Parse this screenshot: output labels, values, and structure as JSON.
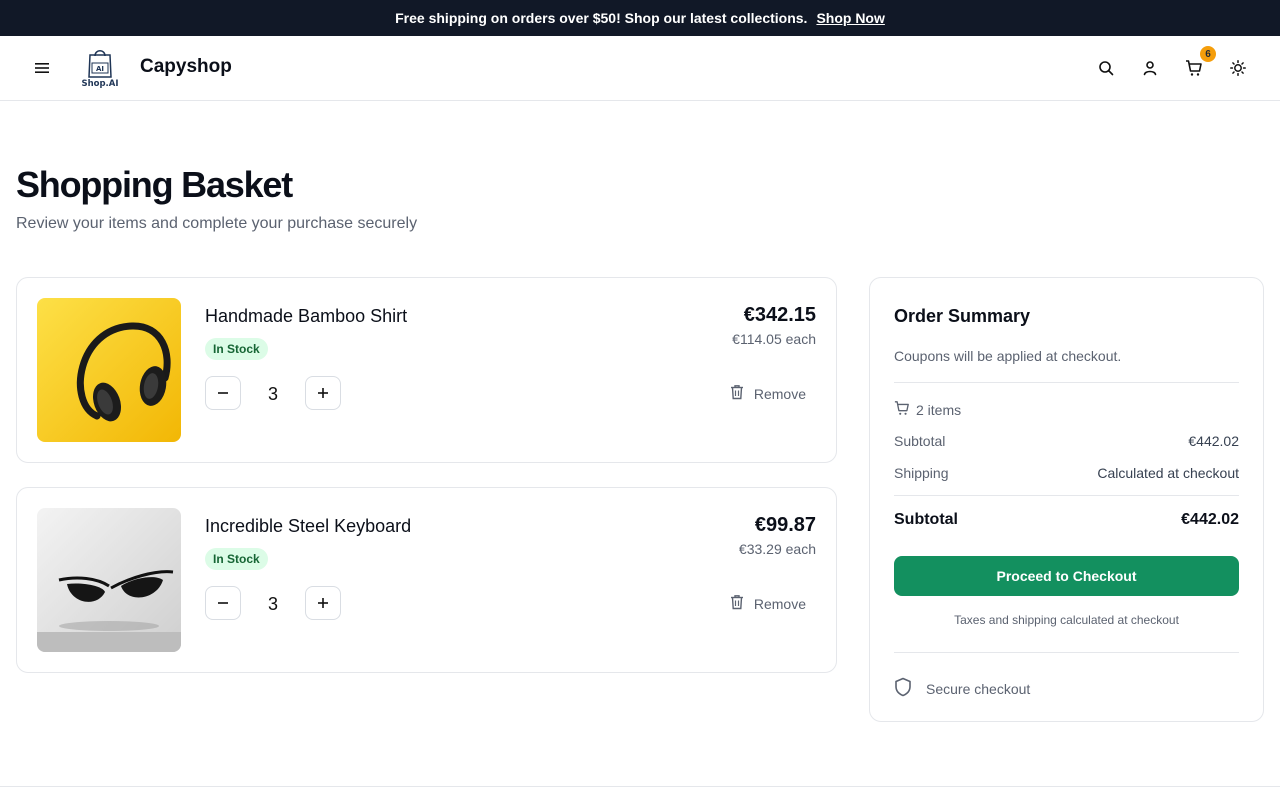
{
  "promo": {
    "text": "Free shipping on orders over $50! Shop our latest collections.",
    "link": "Shop Now"
  },
  "header": {
    "brand": "Capyshop",
    "logo_text": "Shop.AI",
    "cart_count": "6",
    "icons": [
      "menu-icon",
      "search-icon",
      "user-icon",
      "cart-icon",
      "sun-icon"
    ]
  },
  "page": {
    "title": "Shopping Basket",
    "subtitle": "Review your items and complete your purchase securely"
  },
  "items": [
    {
      "name": "Handmade Bamboo Shirt",
      "stock": "In Stock",
      "quantity": "3",
      "price": "€342.15",
      "each": "€114.05 each",
      "remove": "Remove",
      "image": "headphones-on-yellow"
    },
    {
      "name": "Incredible Steel Keyboard",
      "stock": "In Stock",
      "quantity": "3",
      "price": "€99.87",
      "each": "€33.29 each",
      "remove": "Remove",
      "image": "sunglasses-on-white"
    }
  ],
  "summary": {
    "title": "Order Summary",
    "coupon_note": "Coupons will be applied at checkout.",
    "items_count": "2 items",
    "subtotal_label": "Subtotal",
    "subtotal_value": "€442.02",
    "shipping_label": "Shipping",
    "shipping_value": "Calculated at checkout",
    "total_label": "Subtotal",
    "total_value": "€442.02",
    "checkout_label": "Proceed to Checkout",
    "tax_note": "Taxes and shipping calculated at checkout",
    "secure_label": "Secure checkout"
  },
  "colors": {
    "promo_bg": "#111827",
    "accent": "#13905f",
    "badge": "#f59e0b",
    "stock_bg": "#dcfce7",
    "stock_text": "#166534"
  }
}
